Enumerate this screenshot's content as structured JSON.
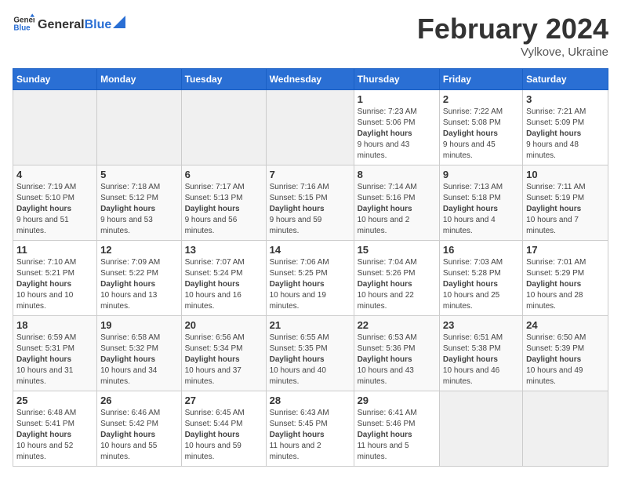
{
  "header": {
    "logo_general": "General",
    "logo_blue": "Blue",
    "title": "February 2024",
    "subtitle": "Vylkove, Ukraine"
  },
  "weekdays": [
    "Sunday",
    "Monday",
    "Tuesday",
    "Wednesday",
    "Thursday",
    "Friday",
    "Saturday"
  ],
  "weeks": [
    [
      {
        "day": "",
        "sunrise": "",
        "sunset": "",
        "daylight": "",
        "empty": true
      },
      {
        "day": "",
        "sunrise": "",
        "sunset": "",
        "daylight": "",
        "empty": true
      },
      {
        "day": "",
        "sunrise": "",
        "sunset": "",
        "daylight": "",
        "empty": true
      },
      {
        "day": "",
        "sunrise": "",
        "sunset": "",
        "daylight": "",
        "empty": true
      },
      {
        "day": "1",
        "sunrise": "7:23 AM",
        "sunset": "5:06 PM",
        "daylight": "9 hours and 43 minutes."
      },
      {
        "day": "2",
        "sunrise": "7:22 AM",
        "sunset": "5:08 PM",
        "daylight": "9 hours and 45 minutes."
      },
      {
        "day": "3",
        "sunrise": "7:21 AM",
        "sunset": "5:09 PM",
        "daylight": "9 hours and 48 minutes."
      }
    ],
    [
      {
        "day": "4",
        "sunrise": "7:19 AM",
        "sunset": "5:10 PM",
        "daylight": "9 hours and 51 minutes."
      },
      {
        "day": "5",
        "sunrise": "7:18 AM",
        "sunset": "5:12 PM",
        "daylight": "9 hours and 53 minutes."
      },
      {
        "day": "6",
        "sunrise": "7:17 AM",
        "sunset": "5:13 PM",
        "daylight": "9 hours and 56 minutes."
      },
      {
        "day": "7",
        "sunrise": "7:16 AM",
        "sunset": "5:15 PM",
        "daylight": "9 hours and 59 minutes."
      },
      {
        "day": "8",
        "sunrise": "7:14 AM",
        "sunset": "5:16 PM",
        "daylight": "10 hours and 2 minutes."
      },
      {
        "day": "9",
        "sunrise": "7:13 AM",
        "sunset": "5:18 PM",
        "daylight": "10 hours and 4 minutes."
      },
      {
        "day": "10",
        "sunrise": "7:11 AM",
        "sunset": "5:19 PM",
        "daylight": "10 hours and 7 minutes."
      }
    ],
    [
      {
        "day": "11",
        "sunrise": "7:10 AM",
        "sunset": "5:21 PM",
        "daylight": "10 hours and 10 minutes."
      },
      {
        "day": "12",
        "sunrise": "7:09 AM",
        "sunset": "5:22 PM",
        "daylight": "10 hours and 13 minutes."
      },
      {
        "day": "13",
        "sunrise": "7:07 AM",
        "sunset": "5:24 PM",
        "daylight": "10 hours and 16 minutes."
      },
      {
        "day": "14",
        "sunrise": "7:06 AM",
        "sunset": "5:25 PM",
        "daylight": "10 hours and 19 minutes."
      },
      {
        "day": "15",
        "sunrise": "7:04 AM",
        "sunset": "5:26 PM",
        "daylight": "10 hours and 22 minutes."
      },
      {
        "day": "16",
        "sunrise": "7:03 AM",
        "sunset": "5:28 PM",
        "daylight": "10 hours and 25 minutes."
      },
      {
        "day": "17",
        "sunrise": "7:01 AM",
        "sunset": "5:29 PM",
        "daylight": "10 hours and 28 minutes."
      }
    ],
    [
      {
        "day": "18",
        "sunrise": "6:59 AM",
        "sunset": "5:31 PM",
        "daylight": "10 hours and 31 minutes."
      },
      {
        "day": "19",
        "sunrise": "6:58 AM",
        "sunset": "5:32 PM",
        "daylight": "10 hours and 34 minutes."
      },
      {
        "day": "20",
        "sunrise": "6:56 AM",
        "sunset": "5:34 PM",
        "daylight": "10 hours and 37 minutes."
      },
      {
        "day": "21",
        "sunrise": "6:55 AM",
        "sunset": "5:35 PM",
        "daylight": "10 hours and 40 minutes."
      },
      {
        "day": "22",
        "sunrise": "6:53 AM",
        "sunset": "5:36 PM",
        "daylight": "10 hours and 43 minutes."
      },
      {
        "day": "23",
        "sunrise": "6:51 AM",
        "sunset": "5:38 PM",
        "daylight": "10 hours and 46 minutes."
      },
      {
        "day": "24",
        "sunrise": "6:50 AM",
        "sunset": "5:39 PM",
        "daylight": "10 hours and 49 minutes."
      }
    ],
    [
      {
        "day": "25",
        "sunrise": "6:48 AM",
        "sunset": "5:41 PM",
        "daylight": "10 hours and 52 minutes."
      },
      {
        "day": "26",
        "sunrise": "6:46 AM",
        "sunset": "5:42 PM",
        "daylight": "10 hours and 55 minutes."
      },
      {
        "day": "27",
        "sunrise": "6:45 AM",
        "sunset": "5:44 PM",
        "daylight": "10 hours and 59 minutes."
      },
      {
        "day": "28",
        "sunrise": "6:43 AM",
        "sunset": "5:45 PM",
        "daylight": "11 hours and 2 minutes."
      },
      {
        "day": "29",
        "sunrise": "6:41 AM",
        "sunset": "5:46 PM",
        "daylight": "11 hours and 5 minutes."
      },
      {
        "day": "",
        "sunrise": "",
        "sunset": "",
        "daylight": "",
        "empty": true
      },
      {
        "day": "",
        "sunrise": "",
        "sunset": "",
        "daylight": "",
        "empty": true
      }
    ]
  ],
  "labels": {
    "sunrise_prefix": "Sunrise: ",
    "sunset_prefix": "Sunset: ",
    "daylight_label": "Daylight hours"
  }
}
